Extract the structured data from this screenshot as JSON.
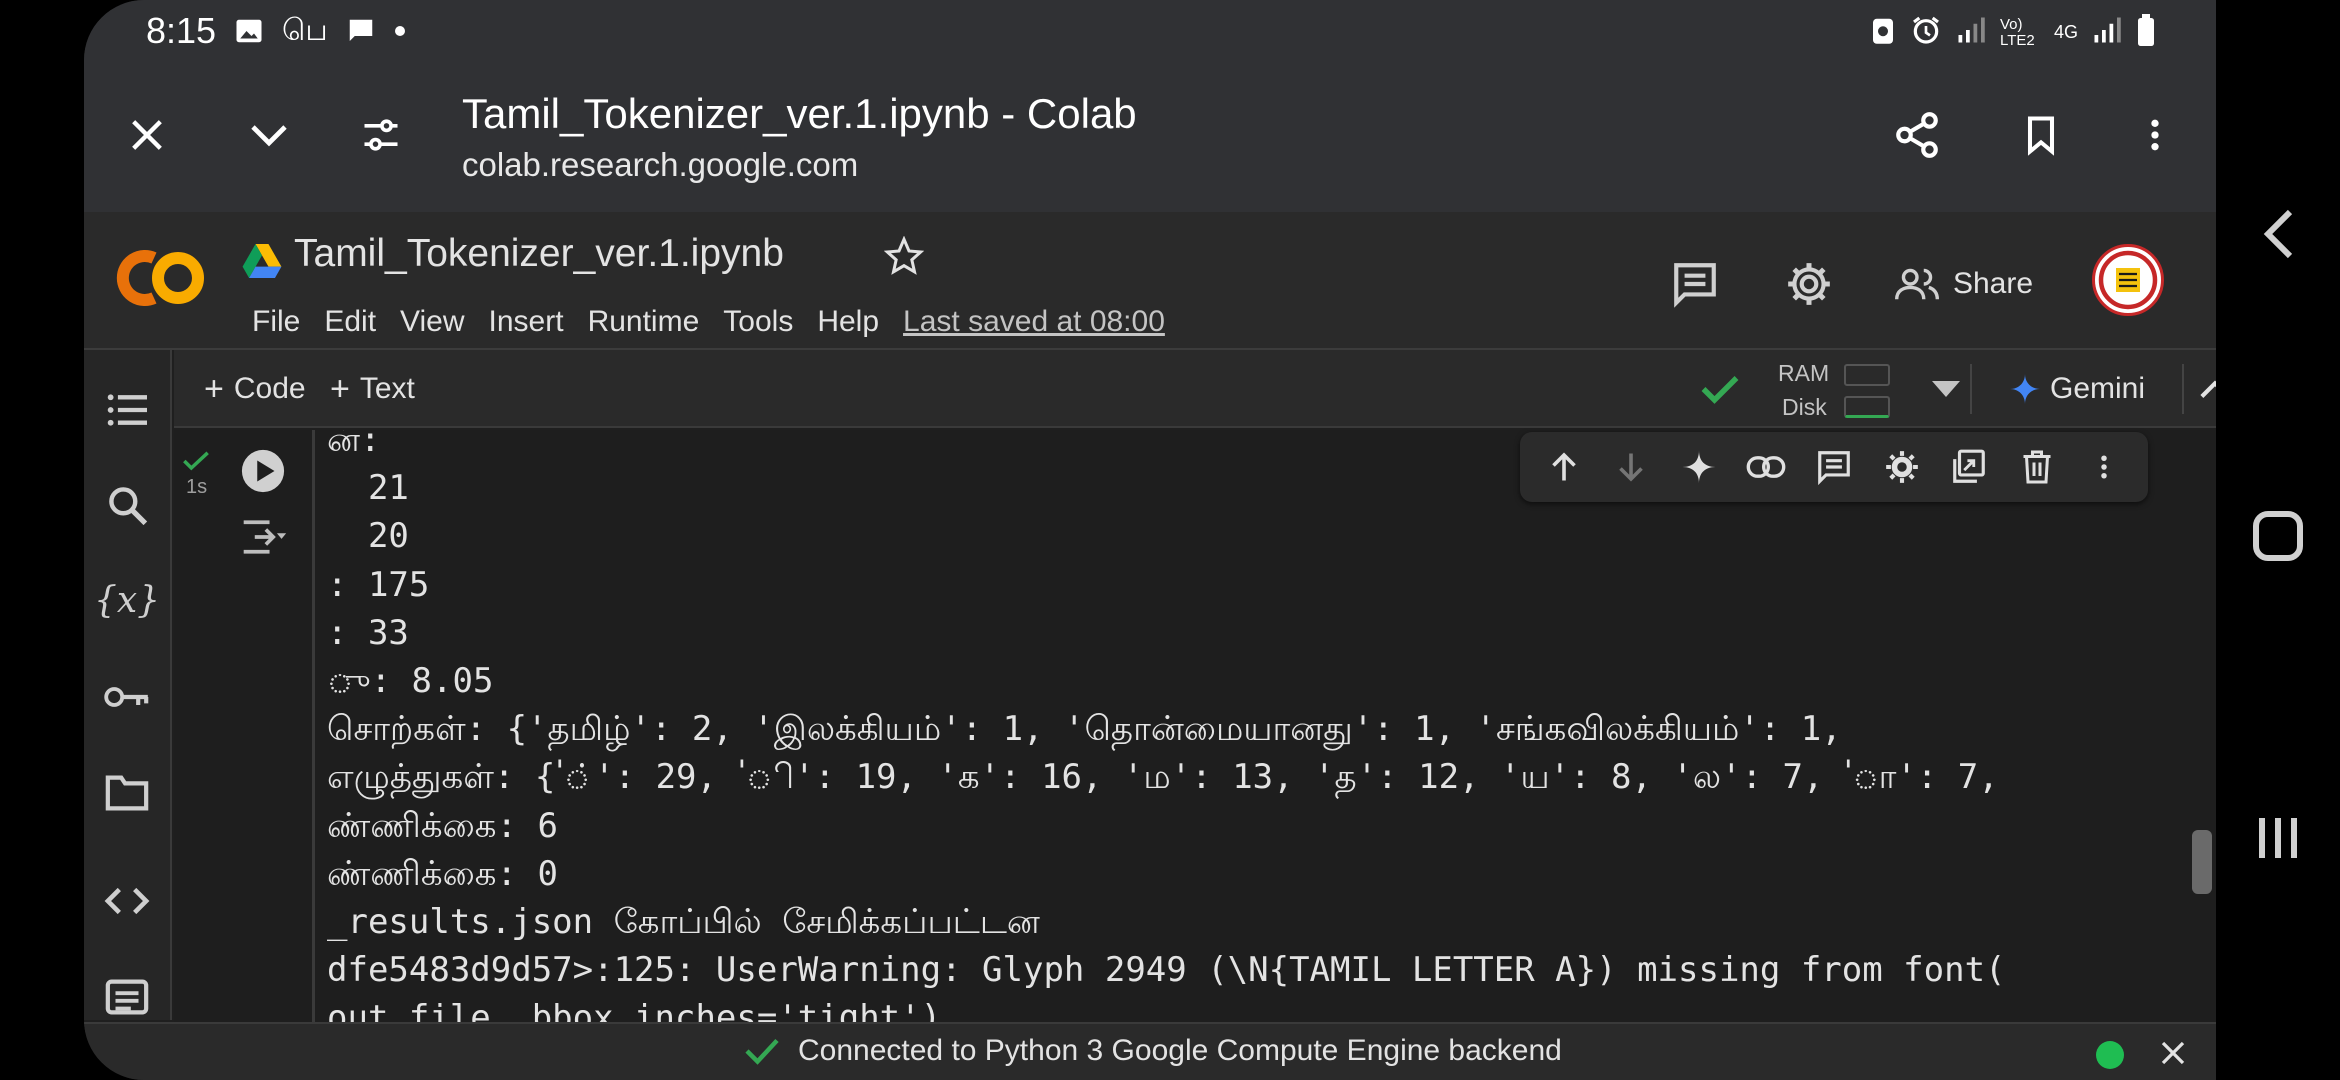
{
  "status_bar": {
    "time": "8:15",
    "network_label": "Vo) LTE2",
    "network_type": "4G"
  },
  "custom_tab": {
    "title": "Tamil_Tokenizer_ver.1.ipynb - Colab",
    "url": "colab.research.google.com"
  },
  "colab": {
    "logo_text": "CO",
    "notebook_name": "Tamil_Tokenizer_ver.1.ipynb",
    "menu": [
      "File",
      "Edit",
      "View",
      "Insert",
      "Runtime",
      "Tools",
      "Help"
    ],
    "last_saved": "Last saved at 08:00",
    "share_label": "Share"
  },
  "toolbar": {
    "code_label": "Code",
    "text_label": "Text",
    "ram_label": "RAM",
    "disk_label": "Disk",
    "gemini_label": "Gemini"
  },
  "cell": {
    "exec_time": "1s",
    "output_lines": [
      "ன்:",
      "  21",
      "  20",
      ": 175",
      ": 33",
      "ு: 8.05",
      "சொற்கள்: {'தமிழ்': 2, 'இலக்கியம்': 1, 'தொன்மையானது': 1, 'சங்கவிலக்கியம்': 1,",
      "எழுத்துகள்: {'்': 29, 'ி': 19, 'க': 16, 'ம': 13, 'த': 12, 'ய': 8, 'ல': 7, 'ா': 7,",
      "ண்ணிக்கை: 6",
      "ண்ணிக்கை: 0",
      "_results.json கோப்பில் சேமிக்கப்பட்டன",
      "dfe5483d9d57>:125: UserWarning: Glyph 2949 (\\N{TAMIL LETTER A}) missing from font(",
      "out_file, bbox_inches='tight')"
    ]
  },
  "bottom_bar": {
    "message": "Connected to Python 3 Google Compute Engine backend"
  },
  "colors": {
    "accent_orange": "#f9ab00",
    "connected_green": "#1fbd52",
    "check_green": "#34a853",
    "gemini_blue": "#4285f4"
  }
}
